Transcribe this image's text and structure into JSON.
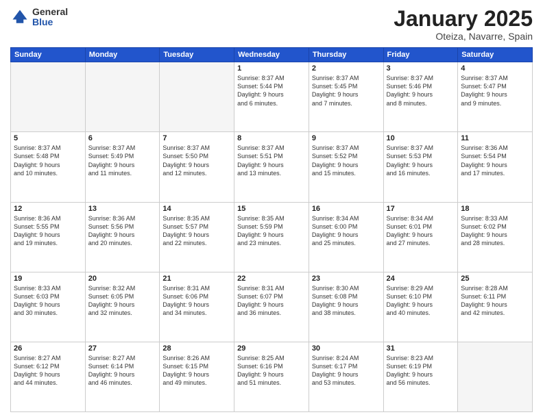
{
  "header": {
    "logo_general": "General",
    "logo_blue": "Blue",
    "month_title": "January 2025",
    "location": "Oteiza, Navarre, Spain"
  },
  "weekdays": [
    "Sunday",
    "Monday",
    "Tuesday",
    "Wednesday",
    "Thursday",
    "Friday",
    "Saturday"
  ],
  "weeks": [
    [
      {
        "day": "",
        "info": ""
      },
      {
        "day": "",
        "info": ""
      },
      {
        "day": "",
        "info": ""
      },
      {
        "day": "1",
        "info": "Sunrise: 8:37 AM\nSunset: 5:44 PM\nDaylight: 9 hours\nand 6 minutes."
      },
      {
        "day": "2",
        "info": "Sunrise: 8:37 AM\nSunset: 5:45 PM\nDaylight: 9 hours\nand 7 minutes."
      },
      {
        "day": "3",
        "info": "Sunrise: 8:37 AM\nSunset: 5:46 PM\nDaylight: 9 hours\nand 8 minutes."
      },
      {
        "day": "4",
        "info": "Sunrise: 8:37 AM\nSunset: 5:47 PM\nDaylight: 9 hours\nand 9 minutes."
      }
    ],
    [
      {
        "day": "5",
        "info": "Sunrise: 8:37 AM\nSunset: 5:48 PM\nDaylight: 9 hours\nand 10 minutes."
      },
      {
        "day": "6",
        "info": "Sunrise: 8:37 AM\nSunset: 5:49 PM\nDaylight: 9 hours\nand 11 minutes."
      },
      {
        "day": "7",
        "info": "Sunrise: 8:37 AM\nSunset: 5:50 PM\nDaylight: 9 hours\nand 12 minutes."
      },
      {
        "day": "8",
        "info": "Sunrise: 8:37 AM\nSunset: 5:51 PM\nDaylight: 9 hours\nand 13 minutes."
      },
      {
        "day": "9",
        "info": "Sunrise: 8:37 AM\nSunset: 5:52 PM\nDaylight: 9 hours\nand 15 minutes."
      },
      {
        "day": "10",
        "info": "Sunrise: 8:37 AM\nSunset: 5:53 PM\nDaylight: 9 hours\nand 16 minutes."
      },
      {
        "day": "11",
        "info": "Sunrise: 8:36 AM\nSunset: 5:54 PM\nDaylight: 9 hours\nand 17 minutes."
      }
    ],
    [
      {
        "day": "12",
        "info": "Sunrise: 8:36 AM\nSunset: 5:55 PM\nDaylight: 9 hours\nand 19 minutes."
      },
      {
        "day": "13",
        "info": "Sunrise: 8:36 AM\nSunset: 5:56 PM\nDaylight: 9 hours\nand 20 minutes."
      },
      {
        "day": "14",
        "info": "Sunrise: 8:35 AM\nSunset: 5:57 PM\nDaylight: 9 hours\nand 22 minutes."
      },
      {
        "day": "15",
        "info": "Sunrise: 8:35 AM\nSunset: 5:59 PM\nDaylight: 9 hours\nand 23 minutes."
      },
      {
        "day": "16",
        "info": "Sunrise: 8:34 AM\nSunset: 6:00 PM\nDaylight: 9 hours\nand 25 minutes."
      },
      {
        "day": "17",
        "info": "Sunrise: 8:34 AM\nSunset: 6:01 PM\nDaylight: 9 hours\nand 27 minutes."
      },
      {
        "day": "18",
        "info": "Sunrise: 8:33 AM\nSunset: 6:02 PM\nDaylight: 9 hours\nand 28 minutes."
      }
    ],
    [
      {
        "day": "19",
        "info": "Sunrise: 8:33 AM\nSunset: 6:03 PM\nDaylight: 9 hours\nand 30 minutes."
      },
      {
        "day": "20",
        "info": "Sunrise: 8:32 AM\nSunset: 6:05 PM\nDaylight: 9 hours\nand 32 minutes."
      },
      {
        "day": "21",
        "info": "Sunrise: 8:31 AM\nSunset: 6:06 PM\nDaylight: 9 hours\nand 34 minutes."
      },
      {
        "day": "22",
        "info": "Sunrise: 8:31 AM\nSunset: 6:07 PM\nDaylight: 9 hours\nand 36 minutes."
      },
      {
        "day": "23",
        "info": "Sunrise: 8:30 AM\nSunset: 6:08 PM\nDaylight: 9 hours\nand 38 minutes."
      },
      {
        "day": "24",
        "info": "Sunrise: 8:29 AM\nSunset: 6:10 PM\nDaylight: 9 hours\nand 40 minutes."
      },
      {
        "day": "25",
        "info": "Sunrise: 8:28 AM\nSunset: 6:11 PM\nDaylight: 9 hours\nand 42 minutes."
      }
    ],
    [
      {
        "day": "26",
        "info": "Sunrise: 8:27 AM\nSunset: 6:12 PM\nDaylight: 9 hours\nand 44 minutes."
      },
      {
        "day": "27",
        "info": "Sunrise: 8:27 AM\nSunset: 6:14 PM\nDaylight: 9 hours\nand 46 minutes."
      },
      {
        "day": "28",
        "info": "Sunrise: 8:26 AM\nSunset: 6:15 PM\nDaylight: 9 hours\nand 49 minutes."
      },
      {
        "day": "29",
        "info": "Sunrise: 8:25 AM\nSunset: 6:16 PM\nDaylight: 9 hours\nand 51 minutes."
      },
      {
        "day": "30",
        "info": "Sunrise: 8:24 AM\nSunset: 6:17 PM\nDaylight: 9 hours\nand 53 minutes."
      },
      {
        "day": "31",
        "info": "Sunrise: 8:23 AM\nSunset: 6:19 PM\nDaylight: 9 hours\nand 56 minutes."
      },
      {
        "day": "",
        "info": ""
      }
    ]
  ]
}
